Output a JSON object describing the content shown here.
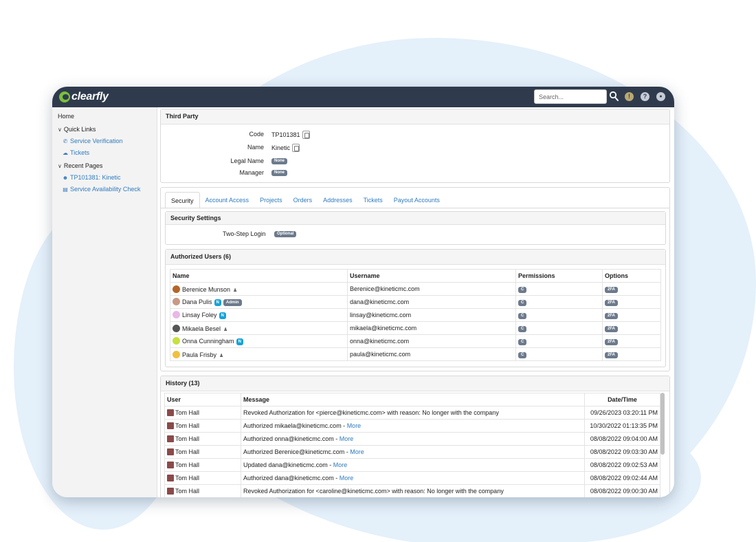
{
  "app": {
    "name": "clearfly",
    "brand_color": "#7bbf3e",
    "topbar_color": "#2f3b4d",
    "link_color": "#2f7bbf"
  },
  "topbar": {
    "search_placeholder": "Search...",
    "icons": [
      "search-icon",
      "alert-icon",
      "help-icon",
      "user-icon"
    ],
    "alert_glyph": "!",
    "help_glyph": "?",
    "user_glyph": "●"
  },
  "sidebar": {
    "home": "Home",
    "quick_links": {
      "label": "Quick Links",
      "items": [
        {
          "label": "Service Verification",
          "icon": "phone-icon"
        },
        {
          "label": "Tickets",
          "icon": "tickets-icon"
        }
      ]
    },
    "recent_pages": {
      "label": "Recent Pages",
      "items": [
        {
          "label": "TP101381: Kinetic",
          "icon": "contact-icon"
        },
        {
          "label": "Service Availability Check",
          "icon": "server-icon"
        }
      ]
    }
  },
  "third_party": {
    "title": "Third Party",
    "fields": [
      {
        "label": "Code",
        "value": "TP101381"
      },
      {
        "label": "Name",
        "value": "Kinetic"
      },
      {
        "label": "Legal Name",
        "value": "None"
      },
      {
        "label": "Manager",
        "value": "None"
      }
    ]
  },
  "tabs": [
    "Security",
    "Account Access",
    "Projects",
    "Orders",
    "Addresses",
    "Tickets",
    "Payout Accounts"
  ],
  "security_settings": {
    "title": "Security Settings",
    "two_step_label": "Two-Step Login",
    "two_step_value": "Optional"
  },
  "authorized_users": {
    "title": "Authorized Users (6)",
    "columns": [
      "Name",
      "Username",
      "Permissions",
      "Options"
    ],
    "rows": [
      {
        "name": "Berenice Munson",
        "badges": [],
        "person_icon": true,
        "username": "Berenice@kineticmc.com",
        "permission": "C",
        "option": "2FA",
        "avatar_color": "#b5652a"
      },
      {
        "name": "Dana Pulis",
        "badges": [
          "N",
          "Admin"
        ],
        "person_icon": false,
        "username": "dana@kineticmc.com",
        "permission": "C",
        "option": "2FA",
        "avatar_color": "#c99a86"
      },
      {
        "name": "Linsay Foley",
        "badges": [
          "N"
        ],
        "person_icon": false,
        "username": "linsay@kineticmc.com",
        "permission": "C",
        "option": "2FA",
        "avatar_color": "#e8b8e8"
      },
      {
        "name": "Mikaela Besel",
        "badges": [],
        "person_icon": true,
        "username": "mikaela@kineticmc.com",
        "permission": "C",
        "option": "2FA",
        "avatar_color": "#555555"
      },
      {
        "name": "Onna Cunningham",
        "badges": [
          "N"
        ],
        "person_icon": false,
        "username": "onna@kineticmc.com",
        "permission": "C",
        "option": "2FA",
        "avatar_color": "#c8e040"
      },
      {
        "name": "Paula Frisby",
        "badges": [],
        "person_icon": true,
        "username": "paula@kineticmc.com",
        "permission": "C",
        "option": "2FA",
        "avatar_color": "#f0c040"
      }
    ]
  },
  "history": {
    "title": "History (13)",
    "columns": [
      "User",
      "Message",
      "Date/Time"
    ],
    "more_label": "More",
    "rows": [
      {
        "user": "Tom Hall",
        "message": "Revoked Authorization for <pierce@kineticmc.com> with reason: No longer with the company",
        "more": false,
        "datetime": "09/26/2023 03:20:11 PM"
      },
      {
        "user": "Tom Hall",
        "message": "Authorized mikaela@kineticmc.com - ",
        "more": true,
        "datetime": "10/30/2022 01:13:35 PM"
      },
      {
        "user": "Tom Hall",
        "message": "Authorized onna@kineticmc.com - ",
        "more": true,
        "datetime": "08/08/2022 09:04:00 AM"
      },
      {
        "user": "Tom Hall",
        "message": "Authorized Berenice@kineticmc.com - ",
        "more": true,
        "datetime": "08/08/2022 09:03:30 AM"
      },
      {
        "user": "Tom Hall",
        "message": "Updated dana@kineticmc.com - ",
        "more": true,
        "datetime": "08/08/2022 09:02:53 AM"
      },
      {
        "user": "Tom Hall",
        "message": "Authorized dana@kineticmc.com - ",
        "more": true,
        "datetime": "08/08/2022 09:02:44 AM"
      },
      {
        "user": "Tom Hall",
        "message": "Revoked Authorization for <caroline@kineticmc.com> with reason: No longer with the company",
        "more": false,
        "datetime": "08/08/2022 09:00:30 AM"
      }
    ]
  }
}
